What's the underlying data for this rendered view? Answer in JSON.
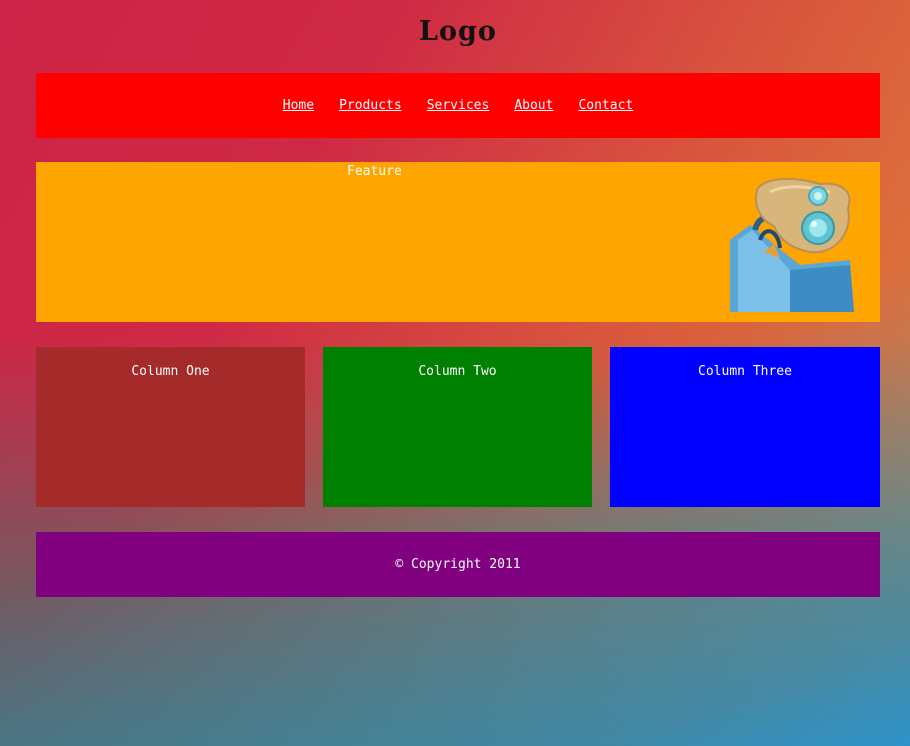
{
  "header": {
    "logo": "Logo"
  },
  "nav": {
    "items": [
      {
        "label": "Home"
      },
      {
        "label": "Products"
      },
      {
        "label": "Services"
      },
      {
        "label": "About"
      },
      {
        "label": "Contact"
      }
    ]
  },
  "feature": {
    "title": "Feature",
    "image_icon": "robot-figure-icon"
  },
  "columns": [
    {
      "label": "Column One",
      "color": "#a52a2a"
    },
    {
      "label": "Column Two",
      "color": "#008000"
    },
    {
      "label": "Column Three",
      "color": "#0000ff"
    }
  ],
  "footer": {
    "copyright": "© Copyright 2011"
  },
  "colors": {
    "nav_bg": "#ff0000",
    "feature_bg": "#ffa500",
    "footer_bg": "#800080"
  }
}
